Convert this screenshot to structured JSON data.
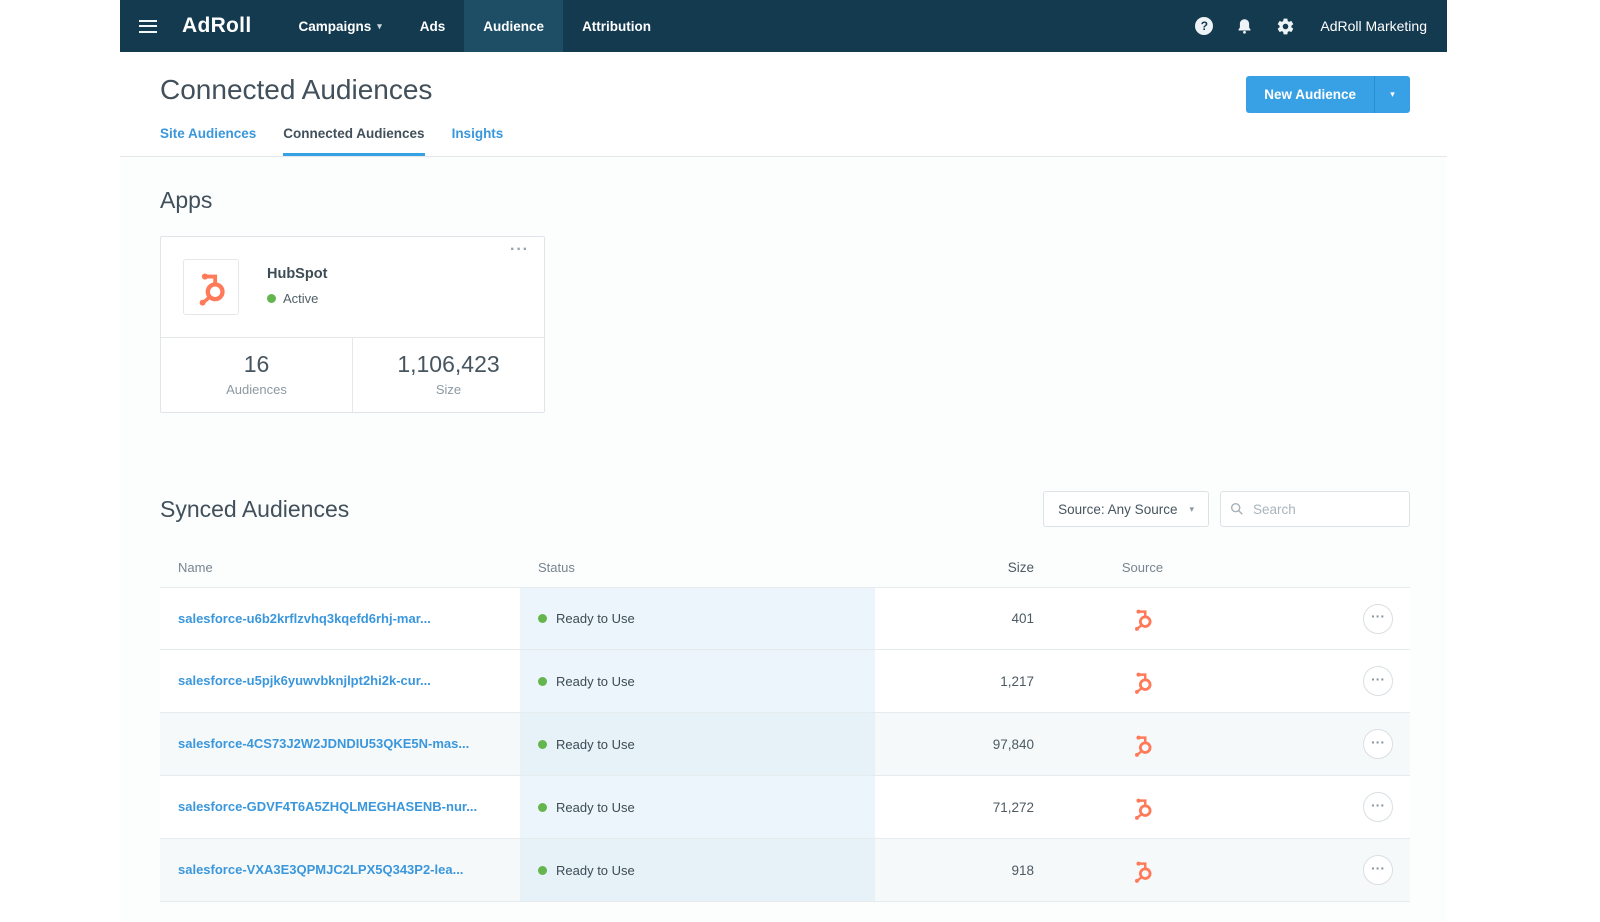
{
  "colors": {
    "nav_dark": "#143a50",
    "accent_blue": "#38a0e4",
    "link_blue": "#3a97dc",
    "hubspot_orange": "#ff7a59",
    "status_green": "#64b54d"
  },
  "icons": {
    "caret_down": "▾",
    "ellipsis": "···",
    "help": "?"
  },
  "topnav": {
    "brand": "AdRoll",
    "items": [
      {
        "label": "Campaigns"
      },
      {
        "label": "Ads"
      },
      {
        "label": "Audience"
      },
      {
        "label": "Attribution"
      }
    ],
    "account": "AdRoll Marketing"
  },
  "header": {
    "title": "Connected Audiences",
    "new_audience_label": "New Audience",
    "tabs": [
      {
        "label": "Site Audiences"
      },
      {
        "label": "Connected Audiences"
      },
      {
        "label": "Insights"
      }
    ]
  },
  "apps": {
    "heading": "Apps",
    "card": {
      "name": "HubSpot",
      "status": "Active",
      "stats": [
        {
          "value": "16",
          "label": "Audiences"
        },
        {
          "value": "1,106,423",
          "label": "Size"
        }
      ]
    }
  },
  "synced": {
    "heading": "Synced Audiences",
    "source_filter": "Source: Any Source",
    "search_placeholder": "Search",
    "columns": [
      "Name",
      "Status",
      "Size",
      "Source"
    ],
    "rows": [
      {
        "name": "salesforce-u6b2krflzvhq3kqefd6rhj-mar...",
        "status": "Ready to Use",
        "size": "401",
        "source": "HubSpot"
      },
      {
        "name": "salesforce-u5pjk6yuwvbknjlpt2hi2k-cur...",
        "status": "Ready to Use",
        "size": "1,217",
        "source": "HubSpot"
      },
      {
        "name": "salesforce-4CS73J2W2JDNDIU53QKE5N-mas...",
        "status": "Ready to Use",
        "size": "97,840",
        "source": "HubSpot"
      },
      {
        "name": "salesforce-GDVF4T6A5ZHQLMEGHASENB-nur...",
        "status": "Ready to Use",
        "size": "71,272",
        "source": "HubSpot"
      },
      {
        "name": "salesforce-VXA3E3QPMJC2LPX5Q343P2-lea...",
        "status": "Ready to Use",
        "size": "918",
        "source": "HubSpot"
      }
    ]
  }
}
